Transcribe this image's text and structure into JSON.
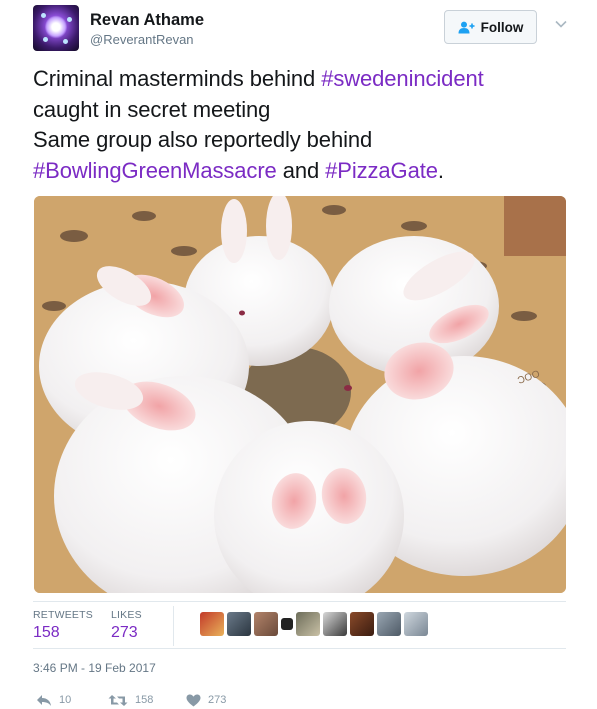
{
  "user": {
    "name": "Revan Athame",
    "handle": "@ReverantRevan"
  },
  "follow_button": {
    "label": "Follow"
  },
  "tweet": {
    "segments": [
      {
        "text": "Criminal masterminds behind ",
        "type": "text"
      },
      {
        "text": "#swedenincident",
        "type": "hashtag"
      },
      {
        "text": "\ncaught in secret meeting\nSame group also reportedly behind\n",
        "type": "text"
      },
      {
        "text": "#BowlingGreenMassacre",
        "type": "hashtag"
      },
      {
        "text": " and ",
        "type": "text"
      },
      {
        "text": "#PizzaGate",
        "type": "hashtag"
      },
      {
        "text": ".",
        "type": "text"
      }
    ]
  },
  "media": {
    "description": "rabbits-photo"
  },
  "stats": {
    "retweets_label": "RETWEETS",
    "retweets_value": "158",
    "likes_label": "LIKES",
    "likes_value": "273"
  },
  "likers": [
    "liker-1",
    "liker-2",
    "liker-3",
    "liker-4",
    "liker-5",
    "liker-6",
    "liker-7",
    "liker-8",
    "liker-9",
    "liker-10",
    "liker-11"
  ],
  "timestamp": "3:46 PM - 19 Feb 2017",
  "actions": {
    "reply_count": "10",
    "retweet_count": "158",
    "like_count": "273"
  },
  "colors": {
    "accent": "#7b2bc4",
    "muted": "#657786",
    "icon": "#8899a6"
  }
}
